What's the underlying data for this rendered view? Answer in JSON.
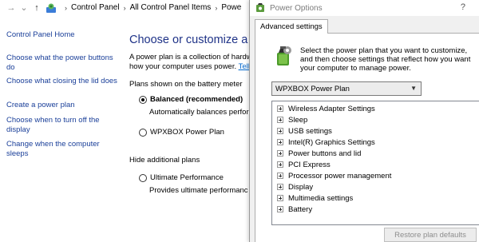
{
  "control_panel": {
    "breadcrumb": [
      "Control Panel",
      "All Control Panel Items",
      "Powe"
    ],
    "home_link": "Control Panel Home",
    "tasks": [
      "Choose what the power buttons do",
      "Choose what closing the lid does",
      "Create a power plan",
      "Choose when to turn off the display",
      "Change when the computer sleeps"
    ],
    "heading": "Choose or customize a pow",
    "desc_line1": "A power plan is a collection of hardw",
    "desc_line2": "how your computer uses power.",
    "desc_link": "Tell",
    "group_label": "Plans shown on the battery meter",
    "plans": [
      {
        "name": "Balanced (recommended)",
        "desc": "Automatically balances perfor",
        "selected": true
      },
      {
        "name": "WPXBOX Power Plan",
        "desc": "",
        "selected": false
      }
    ],
    "hidden_label": "Hide additional plans",
    "hidden_plans": [
      {
        "name": "Ultimate Performance",
        "desc": "Provides ultimate performanc",
        "selected": false
      }
    ]
  },
  "dialog": {
    "title": "Power Options",
    "help": "?",
    "tab": "Advanced settings",
    "instruction": "Select the power plan that you want to customize, and then choose settings that reflect how you want your computer to manage power.",
    "plan_selected": "WPXBOX Power Plan",
    "settings": [
      "Wireless Adapter Settings",
      "Sleep",
      "USB settings",
      "Intel(R) Graphics Settings",
      "Power buttons and lid",
      "PCI Express",
      "Processor power management",
      "Display",
      "Multimedia settings",
      "Battery"
    ],
    "restore_button": "Restore plan defaults"
  }
}
